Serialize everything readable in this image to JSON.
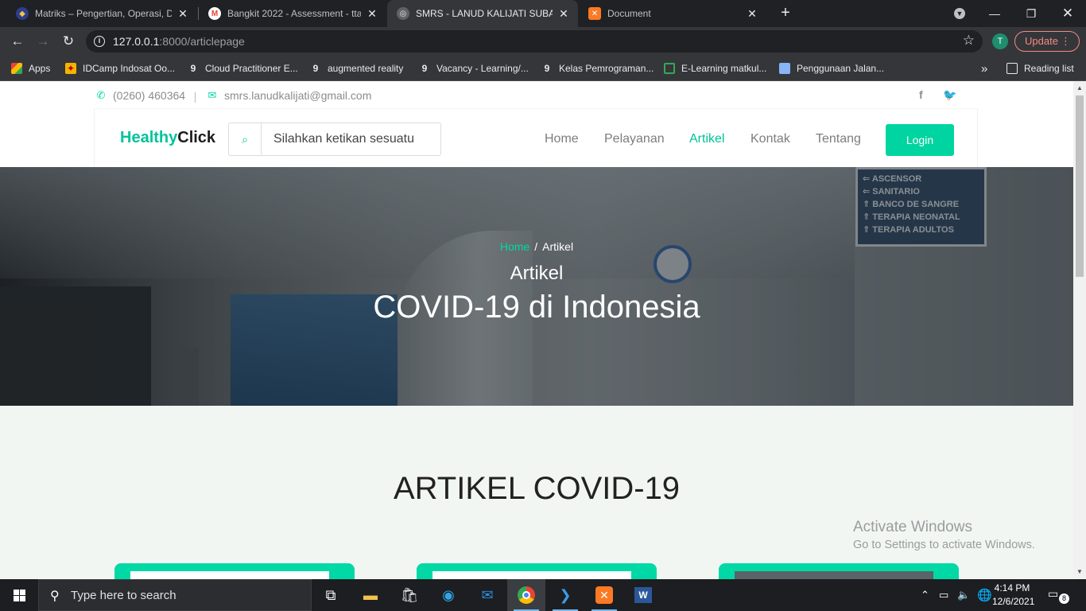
{
  "browser": {
    "tabs": [
      {
        "title": "Matriks – Pengertian, Operasi, De",
        "favicon_color": "#e8a33c"
      },
      {
        "title": "Bangkit 2022 - Assessment - ttan",
        "favicon_color": "#ea4335"
      },
      {
        "title": "SMRS - LANUD KALIJATI SUBANG",
        "favicon_color": "#9aa0a6"
      },
      {
        "title": "Document",
        "favicon_color": "#fb7a24"
      }
    ],
    "url_host": "127.0.0.1",
    "url_rest": ":8000/articlepage",
    "profile_initial": "T",
    "update_label": "Update",
    "bookmarks": [
      {
        "label": "Apps"
      },
      {
        "label": "IDCamp Indosat Oo..."
      },
      {
        "label": "Cloud Practitioner E..."
      },
      {
        "label": "augmented reality"
      },
      {
        "label": "Vacancy - Learning/..."
      },
      {
        "label": "Kelas Pemrograman..."
      },
      {
        "label": "E-Learning matkul..."
      },
      {
        "label": "Penggunaan Jalan..."
      }
    ],
    "reading_list": "Reading list"
  },
  "page": {
    "phone": "(0260) 460364",
    "email": "smrs.lanudkalijati@gmail.com",
    "brand_part1": "Healthy",
    "brand_part2": "Click",
    "search_placeholder": "Silahkan ketikan sesuatu",
    "nav": [
      "Home",
      "Pelayanan",
      "Artikel",
      "Kontak",
      "Tentang"
    ],
    "active_nav": "Artikel",
    "login_label": "Login",
    "breadcrumb_home": "Home",
    "breadcrumb_sep": "/",
    "breadcrumb_current": "Artikel",
    "hero_subtitle": "Artikel",
    "hero_title": "COVID-19 di Indonesia",
    "hero_signs": [
      "ASCENSOR",
      "SANITARIO",
      "BANCO DE SANGRE",
      "TERAPIA NEONATAL",
      "TERAPIA ADULTOS"
    ],
    "section_title": "ARTIKEL COVID-19",
    "accent_color": "#00d4a0"
  },
  "windows": {
    "activate_line1": "Activate Windows",
    "activate_line2": "Go to Settings to activate Windows.",
    "search_placeholder": "Type here to search",
    "time": "4:14 PM",
    "date": "12/6/2021",
    "notification_count": "8"
  }
}
